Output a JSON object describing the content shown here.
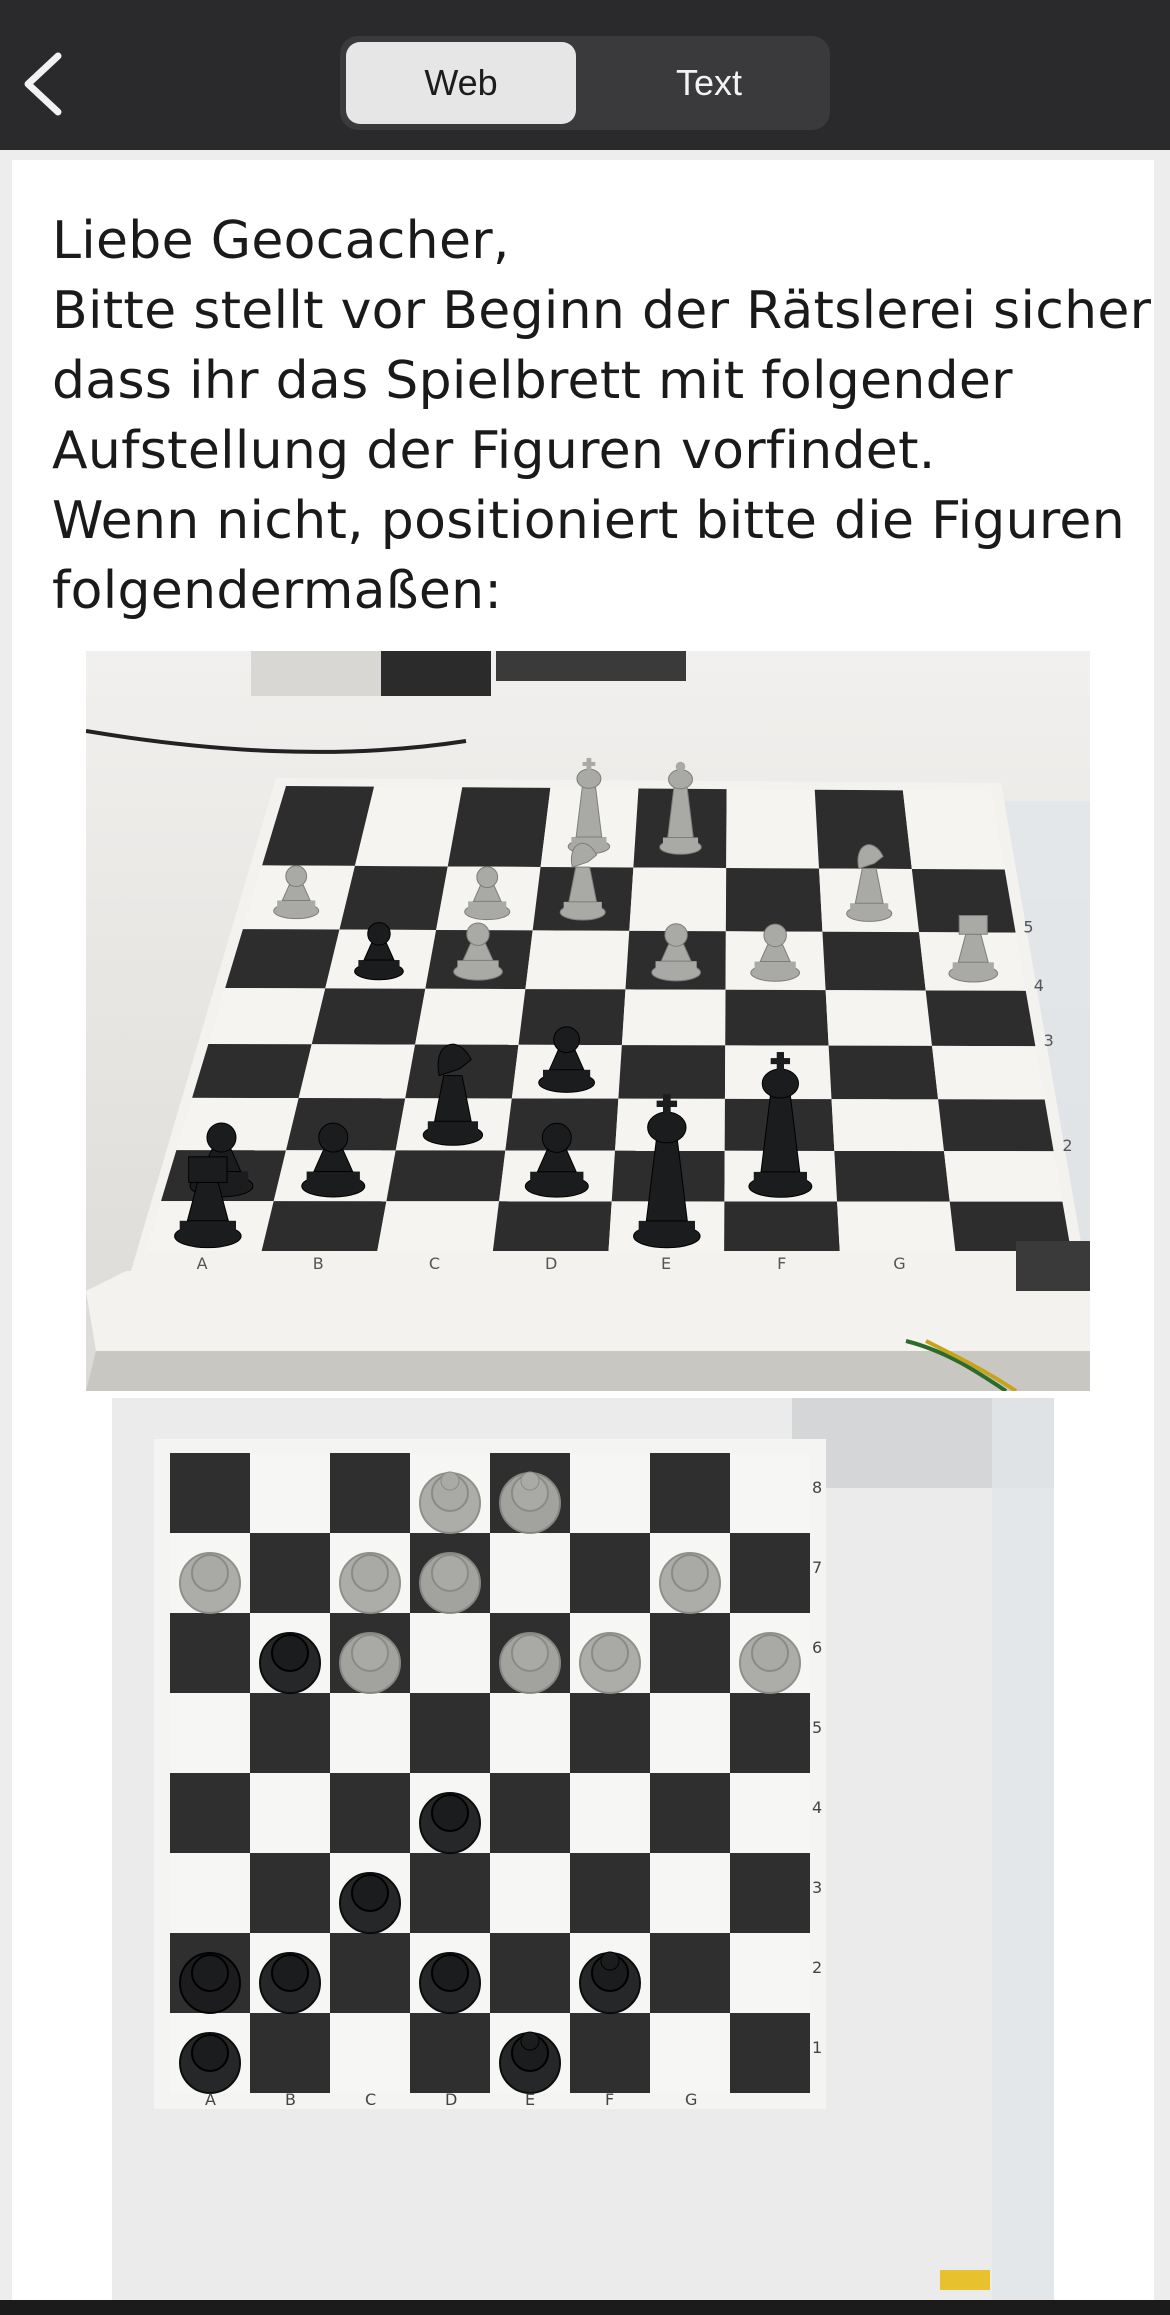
{
  "nav": {
    "back_icon": "chevron-left-icon",
    "segments": [
      "Web",
      "Text"
    ],
    "selected_segment": "Web"
  },
  "content": {
    "intro_lines": [
      "Liebe Geocacher,",
      "Bitte stellt vor Beginn der Rätslerei sicher,",
      "dass ihr das Spielbrett mit folgender",
      "Aufstellung der Figuren vorfindet.",
      "Wenn nicht, positioniert bitte die Figuren",
      "folgendermaßen:"
    ],
    "photo1": {
      "board_file_labels": [
        "A",
        "B",
        "C",
        "D",
        "E",
        "F",
        "G"
      ],
      "board_rank_labels": [
        "2",
        "3",
        "4",
        "5"
      ]
    },
    "photo2": {
      "board_file_labels": [
        "A",
        "B",
        "C",
        "D",
        "E",
        "F",
        "G"
      ],
      "board_rank_labels": [
        "1",
        "2",
        "3",
        "4",
        "5",
        "6",
        "7",
        "8"
      ]
    }
  },
  "colors": {
    "navbar": "#2a2a2c",
    "segment_selected": "#e6e6e6",
    "segment_track": "#3a3a3d",
    "page_background": "#ededed",
    "card": "#ffffff",
    "text": "#1a1a1a",
    "white_pieces": "#a9aaa5",
    "black_pieces": "#1b1c1e"
  }
}
